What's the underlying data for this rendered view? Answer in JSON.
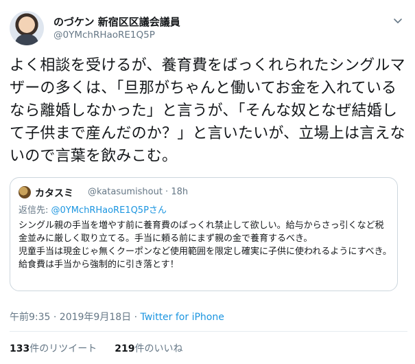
{
  "tweet": {
    "author_name": "のづケン 新宿区区議会議員",
    "author_handle": "@0YMchRHaoRE1Q5P",
    "text": "よく相談を受けるが、養育費をばっくれられたシングルマザーの多くは、「旦那がちゃんと働いてお金を入れているなら離婚しなかった」と言うが、「そんな奴となぜ結婚して子供まで産んだのか？」と言いたいが、立場上は言えないので言葉を飲みこむ。",
    "menu_icon": "chevron-down-icon"
  },
  "quoted": {
    "author_name": "カタスミ",
    "author_handle_time": "@katasumishout · 18h",
    "reply_prefix": "返信先: ",
    "reply_mention": "@0YMchRHaoRE1Q5Pさん",
    "text_1": "シングル親の手当を増やす前に養育費のばっくれ禁止して欲しい。給与からさっ引くなど税金並みに厳しく取り立てる。手当に頼る前にまず親の金で養育するべき。",
    "text_2": "児童手当は現金じゃ無くクーポンなど使用範囲を限定し確実に子供に使われるようにすべき。給食費は手当から強制的に引き落とす！"
  },
  "meta": {
    "time": "午前9:35 · 2019年9月18日 · ",
    "source": "Twitter for iPhone"
  },
  "stats": {
    "retweets_count": "133",
    "retweets_label": "件のリツイート",
    "likes_count": "219",
    "likes_label": "件のいいね"
  }
}
